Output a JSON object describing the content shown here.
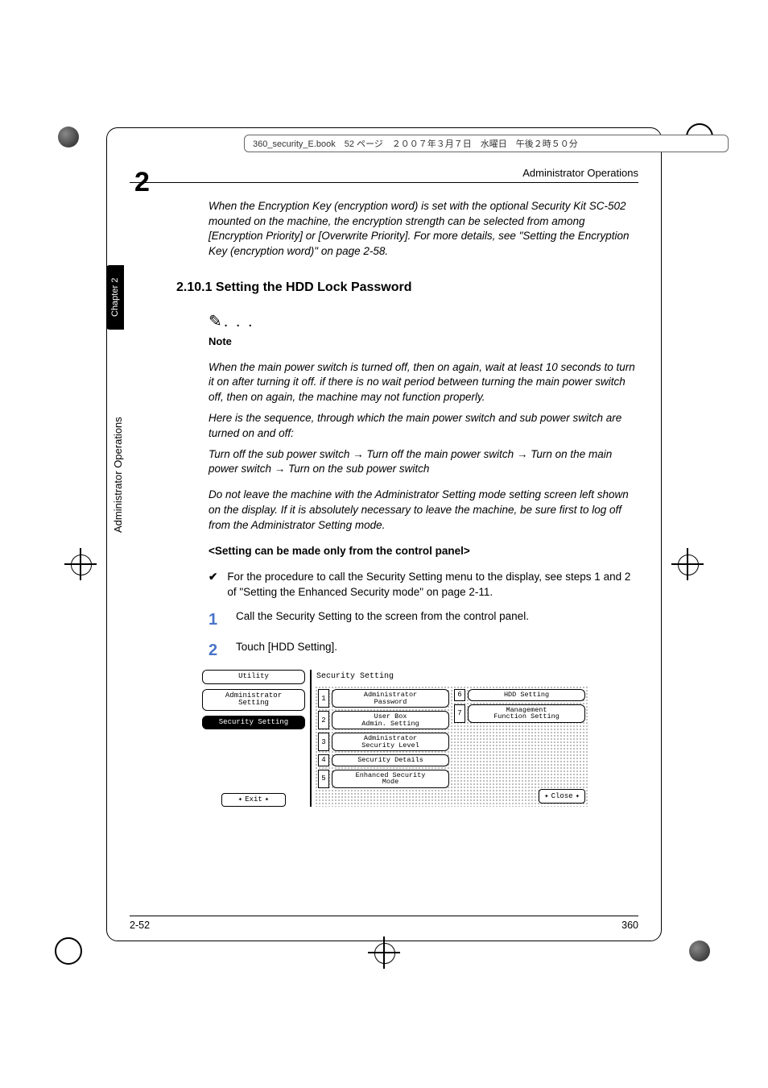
{
  "frame_header": "360_security_E.book　52 ページ　２００７年３月７日　水曜日　午後２時５０分",
  "running_head": "Administrator Operations",
  "chapter_number": "2",
  "side_tab": "Chapter 2",
  "side_label": "Administrator Operations",
  "intro_italic": "When the Encryption Key (encryption word) is set with the optional Security Kit SC-502 mounted on the machine, the encryption strength can be selected from among [Encryption Priority] or [Overwrite Priority]. For more details, see \"Setting the Encryption Key (encryption word)\" on page 2-58.",
  "section_heading": "2.10.1 Setting the HDD Lock Password",
  "note_icon": "✎. . .",
  "note_label": "Note",
  "note_p1": "When the main power switch is turned off, then on again, wait at least 10 seconds to turn it on after turning it off. if there is no wait period between turning the main power switch off, then on again, the machine may not function properly.",
  "note_p2": "Here is the sequence, through which the main power switch and sub power switch are turned on and off:",
  "note_p3": "Turn off the sub power switch → Turn off the main power switch → Turn on the main power switch → Turn on the sub power switch",
  "note_p4": "Do not leave the machine with the Administrator Setting mode setting screen left shown on the display. If it is absolutely necessary to leave the machine, be sure first to log off from the Administrator Setting mode.",
  "subsection_bold": "<Setting can be made only from the control panel>",
  "check_text": "For the procedure to call the Security Setting menu to the display, see steps 1 and 2 of \"Setting the Enhanced Security mode\" on page 2-11.",
  "steps": [
    {
      "n": "1",
      "text": "Call the Security Setting to the screen from the control panel."
    },
    {
      "n": "2",
      "text": "Touch [HDD Setting]."
    }
  ],
  "panel": {
    "left": {
      "utility": "Utility",
      "admin": "Administrator\nSetting",
      "security": "Security Setting",
      "exit": "Exit"
    },
    "title": "Security Setting",
    "options_left": [
      {
        "n": "1",
        "label": "Administrator\nPassword"
      },
      {
        "n": "2",
        "label": "User Box\nAdmin. Setting"
      },
      {
        "n": "3",
        "label": "Administrator\nSecurity Level"
      },
      {
        "n": "4",
        "label": "Security Details"
      },
      {
        "n": "5",
        "label": "Enhanced Security\nMode"
      }
    ],
    "options_right": [
      {
        "n": "6",
        "label": "HDD Setting"
      },
      {
        "n": "7",
        "label": "Management\nFunction Setting"
      }
    ],
    "close": "Close"
  },
  "footer_left": "2-52",
  "footer_right": "360"
}
